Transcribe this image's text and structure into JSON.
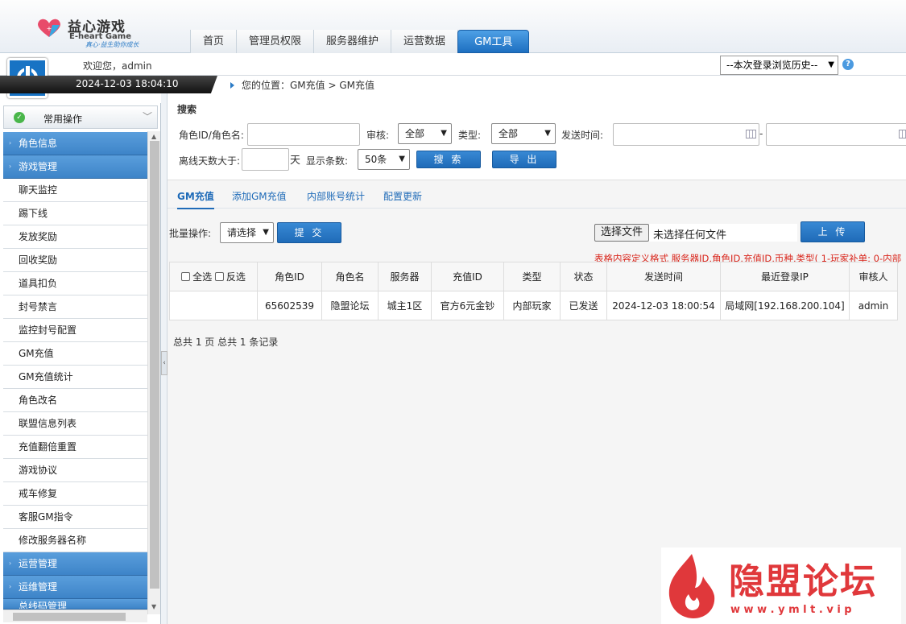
{
  "brand": {
    "name_cn": "益心游戏",
    "name_en": "E-heart Game",
    "slogan": "真心·益生助你成长"
  },
  "topnav": [
    {
      "label": "首页"
    },
    {
      "label": "管理员权限"
    },
    {
      "label": "服务器维护"
    },
    {
      "label": "运营数据"
    },
    {
      "label": "GM工具",
      "active": true
    }
  ],
  "user": {
    "welcome": "欢迎您，admin",
    "datetime": "2024-12-03 18:04:10"
  },
  "history_select": {
    "value": "--本次登录浏览历史--"
  },
  "breadcrumb": "您的位置：GM充值 > GM充值",
  "sidebar": {
    "common": "常用操作",
    "categories": {
      "role": "角色信息",
      "game": "游戏管理",
      "ops": "运营管理",
      "maint": "运维管理",
      "bottom": "总线码管理"
    },
    "items": [
      "聊天监控",
      "踢下线",
      "发放奖励",
      "回收奖励",
      "道具扣负",
      "封号禁言",
      "监控封号配置",
      "GM充值",
      "GM充值统计",
      "角色改名",
      "联盟信息列表",
      "充值翻倍重置",
      "游戏协议",
      "戒车修复",
      "客服GM指令",
      "修改服务器名称"
    ]
  },
  "search": {
    "title": "搜索",
    "role_label": "角色ID/角色名:",
    "audit_label": "审核:",
    "audit_value": "全部",
    "type_label": "类型:",
    "type_value": "全部",
    "send_time_label": "发送时间:",
    "dash": "-",
    "offline_label": "离线天数大于:",
    "day_unit": "天",
    "count_label": "显示条数:",
    "count_value": "50条",
    "search_btn": "搜 索",
    "export_btn": "导 出"
  },
  "tabs": [
    "GM充值",
    "添加GM充值",
    "内部账号统计",
    "配置更新"
  ],
  "batch": {
    "label": "批量操作:",
    "select_value": "请选择",
    "submit_btn": "提 交",
    "file_btn": "选择文件",
    "file_status": "未选择任何文件",
    "upload_btn": "上 传",
    "format_hint": "表格内容定义格式 服务器ID,角色ID,充值ID,币种,类型( 1-玩家补单; 0-内部"
  },
  "table": {
    "select_all": "全选",
    "invert": "反选",
    "headers": [
      "角色ID",
      "角色名",
      "服务器",
      "充值ID",
      "类型",
      "状态",
      "发送时间",
      "最近登录IP",
      "审核人"
    ],
    "rows": [
      [
        "65602539",
        "隐盟论坛",
        "城主1区",
        "官方6元金钞",
        "内部玩家",
        "已发送",
        "2024-12-03 18:00:54",
        "局域网[192.168.200.104]",
        "admin"
      ]
    ]
  },
  "pagination": "总共 1 页 总共 1 条记录",
  "watermark": {
    "title": "隐盟论坛",
    "url": "w w w . y m l t . v i p"
  }
}
